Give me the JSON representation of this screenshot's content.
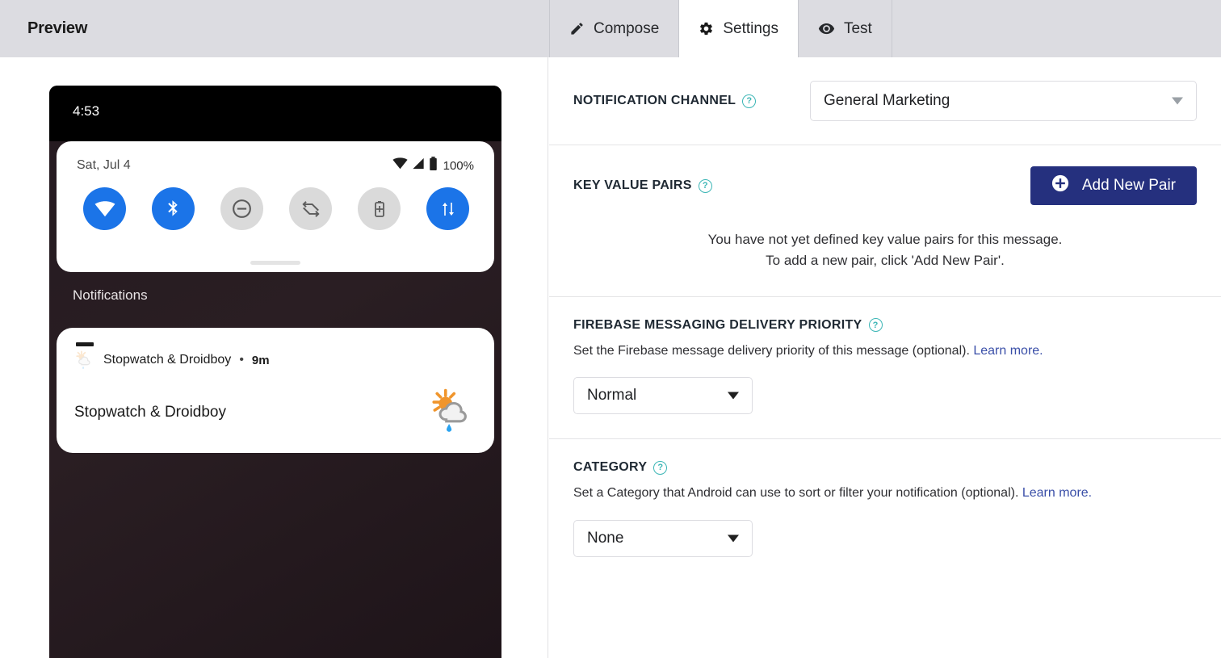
{
  "header": {
    "title": "Preview",
    "tabs": [
      {
        "label": "Compose",
        "icon": "pencil-icon",
        "active": false
      },
      {
        "label": "Settings",
        "icon": "gear-icon",
        "active": true
      },
      {
        "label": "Test",
        "icon": "eye-icon",
        "active": false
      }
    ]
  },
  "phone_preview": {
    "status_time": "4:53",
    "quick_settings": {
      "date": "Sat, Jul 4",
      "battery_percent": "100%",
      "toggles": [
        {
          "name": "wifi-toggle",
          "state": "on"
        },
        {
          "name": "bluetooth-toggle",
          "state": "on"
        },
        {
          "name": "do-not-disturb-toggle",
          "state": "off"
        },
        {
          "name": "auto-rotate-toggle",
          "state": "off"
        },
        {
          "name": "battery-saver-toggle",
          "state": "off"
        },
        {
          "name": "mobile-data-toggle",
          "state": "on"
        }
      ]
    },
    "notifications_label": "Notifications",
    "notification": {
      "app_name": "Stopwatch & Droidboy",
      "separator": "•",
      "time": "9m",
      "title": "Stopwatch & Droidboy",
      "large_icon": "weather-sun-cloud-rain-icon"
    }
  },
  "settings": {
    "notification_channel": {
      "label": "NOTIFICATION CHANNEL",
      "help": "?",
      "value": "General Marketing"
    },
    "key_value_pairs": {
      "label": "KEY VALUE PAIRS",
      "help": "?",
      "add_button": "Add New Pair",
      "empty_line_1": "You have not yet defined key value pairs for this message.",
      "empty_line_2": "To add a new pair, click 'Add New Pair'."
    },
    "delivery_priority": {
      "label": "FIREBASE MESSAGING DELIVERY PRIORITY",
      "help": "?",
      "description": "Set the Firebase message delivery priority of this message (optional). ",
      "link": "Learn more.",
      "value": "Normal"
    },
    "category": {
      "label": "CATEGORY",
      "help": "?",
      "description": "Set a Category that Android can use to sort or filter your notification (optional). ",
      "link": "Learn more.",
      "value": "None"
    }
  },
  "colors": {
    "topbar_bg": "#dcdce1",
    "accent_button": "#25307e",
    "help_teal": "#3cb6b6",
    "link_blue": "#3a4fa8",
    "toggle_on_blue": "#1b74e8"
  }
}
